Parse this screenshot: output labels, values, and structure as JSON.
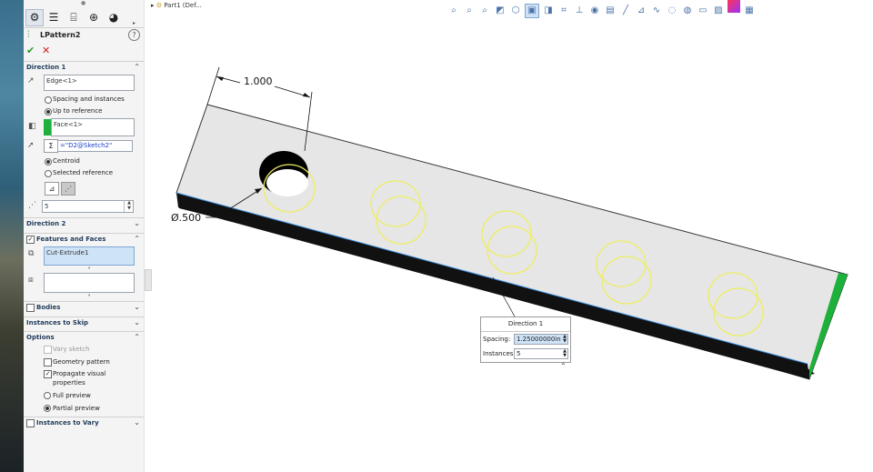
{
  "breadcrumb": {
    "text": "Part1  (Def..."
  },
  "panel": {
    "feature_title": "LPattern2",
    "help_icon": "?",
    "ok_icon": "check-icon",
    "cancel_icon": "close-icon"
  },
  "direction1": {
    "header": "Direction 1",
    "edge_field": "Edge<1>",
    "radio_spacing": "Spacing and instances",
    "radio_upto": "Up to reference",
    "face_field": "Face<1>",
    "equation_field": "=\"D2@Sketch2\"",
    "radio_centroid": "Centroid",
    "radio_selected_ref": "Selected reference",
    "instances_value": "5"
  },
  "direction2": {
    "header": "Direction 2"
  },
  "features_faces": {
    "header": "Features and Faces",
    "feature_field": "Cut-Extrude1"
  },
  "bodies": {
    "header": "Bodies"
  },
  "instances_to_skip": {
    "header": "Instances to Skip"
  },
  "options": {
    "header": "Options",
    "vary_sketch": "Vary sketch",
    "geometry_pattern": "Geometry pattern",
    "propagate_visual_line1": "Propagate visual",
    "propagate_visual_line2": "properties",
    "full_preview": "Full preview",
    "partial_preview": "Partial preview"
  },
  "instances_to_vary": {
    "header": "Instances to Vary"
  },
  "graphics": {
    "dim_distance": "1.000",
    "dim_diameter": "Ø.500"
  },
  "callout": {
    "title": "Direction 1",
    "spacing_label": "Spacing:",
    "spacing_value": "1.25000000in",
    "instances_label": "Instances:",
    "instances_value": "5"
  },
  "colors": {
    "accent_green": "#1db13b",
    "preview_yellow": "#eeee60",
    "selection_blue": "#cfe3f7"
  }
}
